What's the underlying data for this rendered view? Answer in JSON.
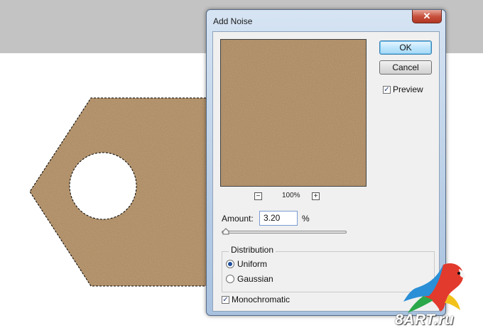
{
  "dialog": {
    "title": "Add Noise",
    "close_label": "✕",
    "ok_label": "OK",
    "cancel_label": "Cancel",
    "preview_label": "Preview",
    "preview_checked": true,
    "zoom_out_label": "−",
    "zoom_in_label": "+",
    "zoom_level": "100%",
    "amount_label": "Amount:",
    "amount_value": "3.20",
    "amount_unit": "%",
    "amount_slider_fraction": 0.02,
    "distribution_label": "Distribution",
    "uniform_label": "Uniform",
    "gaussian_label": "Gaussian",
    "selected_distribution": "Uniform",
    "monochromatic_label": "Monochromatic",
    "monochromatic_checked": true
  },
  "canvas": {
    "background_band_color": "#c3c3c3",
    "tag_color": "#c4a177",
    "selection": "marching-ants"
  },
  "watermark": {
    "text": "8ART.ru",
    "logo": "parrot-icon"
  },
  "colors": {
    "noise_fill": "#c4a177",
    "dialog_frame": "#b9cee6",
    "ok_accent": "#3c7fb1"
  }
}
